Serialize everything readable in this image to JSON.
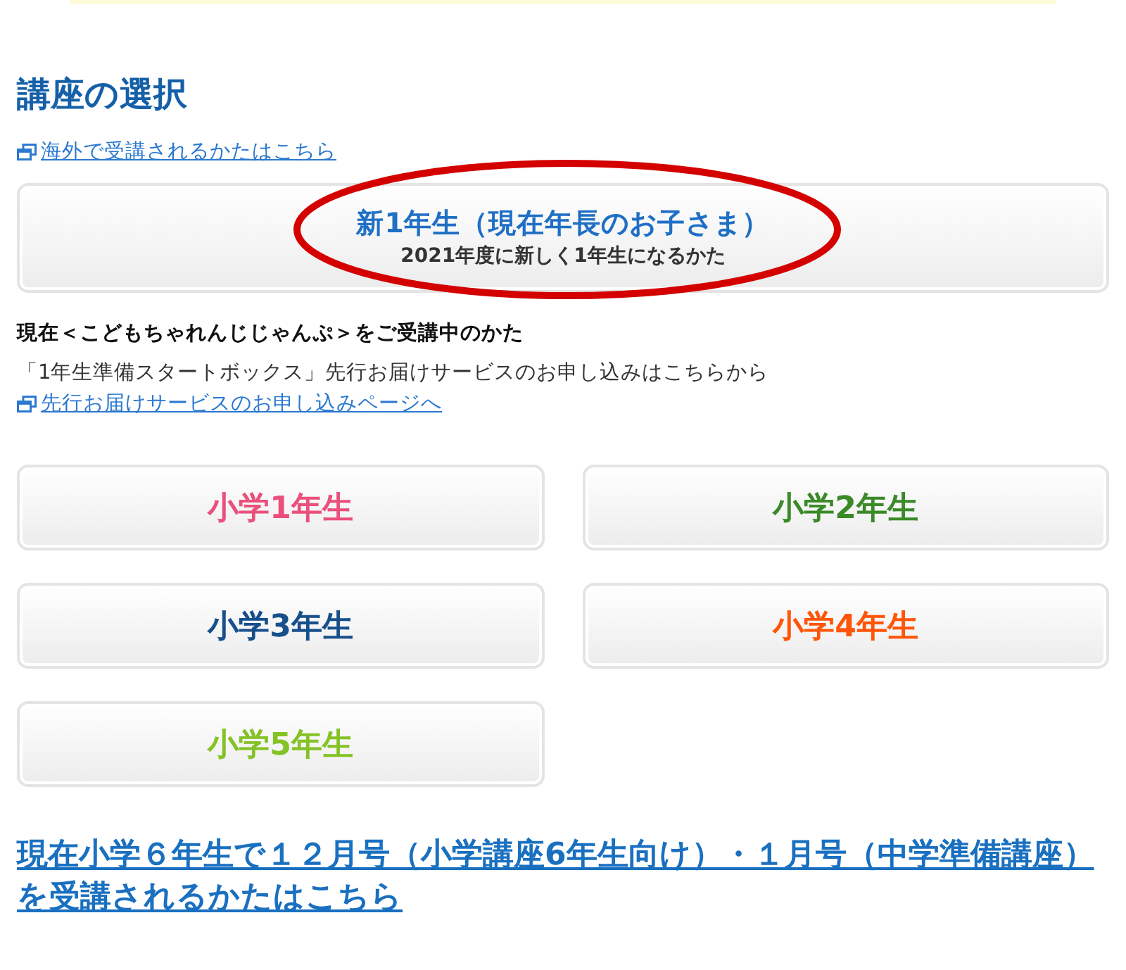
{
  "heading": "講座の選択",
  "overseas_link": "海外で受講されるかたはこちら",
  "new_first_grade_button": {
    "title": "新1年生（現在年長のお子さま）",
    "subtitle": "2021年度に新しく1年生になるかた",
    "circled": true
  },
  "current_members": {
    "heading": "現在＜こどもちゃれんじじゃんぷ＞をご受講中のかた",
    "text": "「1年生準備スタートボックス」先行お届けサービスのお申し込みはこちらから",
    "link": "先行お届けサービスのお申し込みページへ"
  },
  "grade_buttons": [
    {
      "label": "小学1年生",
      "color": "#eb4f7b"
    },
    {
      "label": "小学2年生",
      "color": "#3a8a28"
    },
    {
      "label": "小学3年生",
      "color": "#174f8c"
    },
    {
      "label": "小学4年生",
      "color": "#ff5508"
    },
    {
      "label": "小学5年生",
      "color": "#84c226"
    }
  ],
  "sixth_grade_link": "現在小学６年生で１２月号（小学講座6年生向け）・１月号（中学準備講座）を受講されるかたはこちら"
}
